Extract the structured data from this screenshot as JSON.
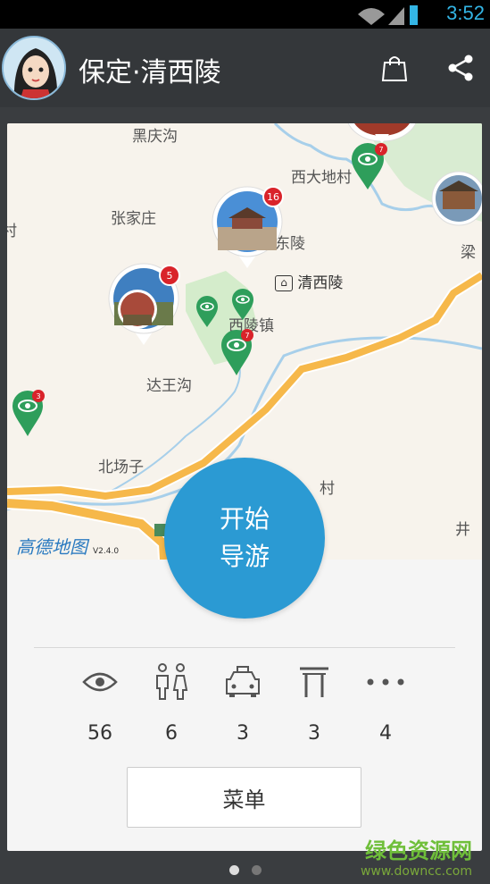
{
  "status_bar": {
    "time": "3:52"
  },
  "app_bar": {
    "title": "保定·清西陵"
  },
  "map": {
    "labels": {
      "heiqinggou": "黑庆沟",
      "xidadicun": "西大地村",
      "zhangjiazhuang": "张家庄",
      "dongling": "东陵",
      "qingxiling": "清西陵",
      "xilingzhen": "西陵镇",
      "dawanggou": "达王沟",
      "beichangzi": "北场子",
      "cun": "村",
      "liang": "梁",
      "jing": "井",
      "left_edge": "村"
    },
    "markers": {
      "main_count": "16",
      "left_count": "5",
      "eye_badge": "7",
      "top_right_count": "7",
      "left_edge_count": "3"
    },
    "provider": "高德地图",
    "version": "V2.4.0"
  },
  "start_button": {
    "line1": "开始",
    "line2": "导游"
  },
  "stats": [
    {
      "icon": "eye-icon",
      "count": "56"
    },
    {
      "icon": "restroom-icon",
      "count": "6"
    },
    {
      "icon": "taxi-icon",
      "count": "3"
    },
    {
      "icon": "gate-icon",
      "count": "3"
    },
    {
      "icon": "more-icon",
      "count": "4"
    }
  ],
  "menu_button": {
    "label": "菜单"
  },
  "watermark": {
    "main": "绿色资源网",
    "sub": "www.downcc.com"
  },
  "colors": {
    "accent": "#2b9ad3",
    "marker_green": "#2e9e5b",
    "badge_red": "#d9232a"
  }
}
